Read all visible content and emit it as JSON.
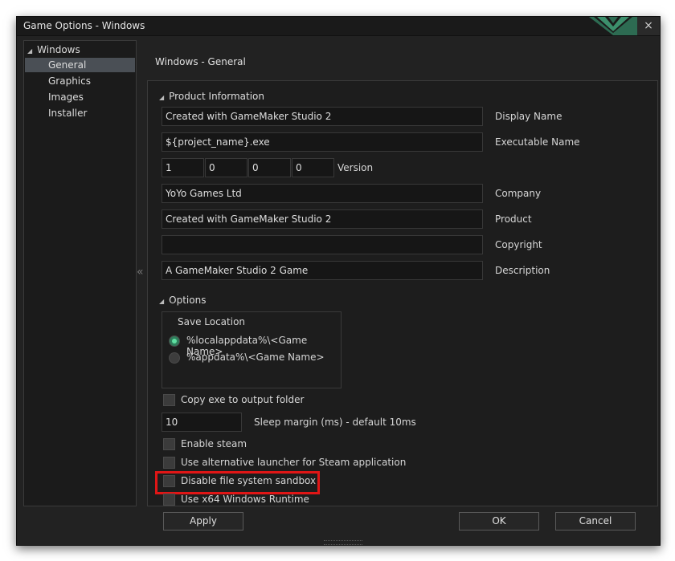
{
  "window": {
    "title": "Game Options - Windows",
    "close_icon": "×"
  },
  "tree": {
    "root": "Windows",
    "items": [
      {
        "label": "General",
        "selected": true
      },
      {
        "label": "Graphics",
        "selected": false
      },
      {
        "label": "Images",
        "selected": false
      },
      {
        "label": "Installer",
        "selected": false
      }
    ]
  },
  "collapse_icon": "«",
  "header": "Windows - General",
  "product_info": {
    "title": "Product Information",
    "display_name": {
      "value": "Created with GameMaker Studio 2",
      "label": "Display Name"
    },
    "executable_name": {
      "value": "${project_name}.exe",
      "label": "Executable Name"
    },
    "version": {
      "major": "1",
      "minor": "0",
      "build": "0",
      "revision": "0",
      "label": "Version"
    },
    "company": {
      "value": "YoYo Games Ltd",
      "label": "Company"
    },
    "product": {
      "value": "Created with GameMaker Studio 2",
      "label": "Product"
    },
    "copyright": {
      "value": "",
      "label": "Copyright"
    },
    "description": {
      "value": "A GameMaker Studio 2 Game",
      "label": "Description"
    }
  },
  "options": {
    "title": "Options",
    "save_location": {
      "title": "Save Location",
      "choices": [
        {
          "label": "%localappdata%\\<Game Name>",
          "selected": true
        },
        {
          "label": "%appdata%\\<Game Name>",
          "selected": false
        }
      ]
    },
    "copy_exe": {
      "label": "Copy exe to output folder",
      "checked": false
    },
    "sleep_margin": {
      "value": "10",
      "label": "Sleep margin (ms) - default 10ms"
    },
    "enable_steam": {
      "label": "Enable steam",
      "checked": false
    },
    "alt_launcher": {
      "label": "Use alternative launcher for Steam application",
      "checked": false
    },
    "disable_sandbox": {
      "label": "Disable file system sandbox",
      "checked": false
    },
    "x64_runtime": {
      "label": "Use x64 Windows Runtime",
      "checked": false
    }
  },
  "buttons": {
    "apply": "Apply",
    "ok": "OK",
    "cancel": "Cancel"
  },
  "colors": {
    "accent": "#2f7d5b",
    "highlight": "#e01616",
    "background": "#222222"
  }
}
